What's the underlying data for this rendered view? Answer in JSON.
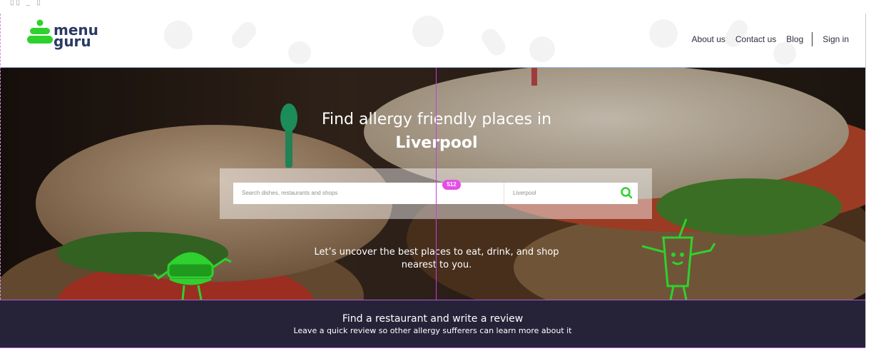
{
  "brand": {
    "line1": "menu",
    "line2": "guru"
  },
  "nav": {
    "about": "About us",
    "contact": "Contact us",
    "blog": "Blog",
    "signin": "Sign in"
  },
  "hero": {
    "title_line1": "Find allergy friendly places in",
    "city": "Liverpool",
    "search": {
      "dishes_placeholder": "Search dishes, restaurants and shops",
      "location_value": "Liverpool"
    },
    "badge": "512",
    "tagline_line1": "Let’s uncover the best places to eat, drink, and shop",
    "tagline_line2": "nearest to you."
  },
  "promo": {
    "heading": "Find a restaurant and write a review",
    "subtext": "Leave a quick review so other allergy sufferers can learn more about it"
  },
  "colors": {
    "accent_green": "#2ed12e",
    "dark_navy": "#262339",
    "badge_pink": "#e64de6"
  }
}
